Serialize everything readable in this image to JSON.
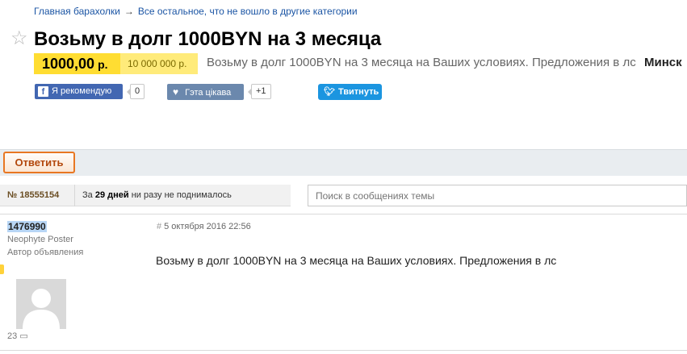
{
  "breadcrumb": {
    "items": [
      "Главная барахолки",
      "Все остальное, что не вошло в другие категории"
    ],
    "separator": "→"
  },
  "header": {
    "title": "Возьму в долг 1000BYN на 3 месяца",
    "star_icon": "star-icon"
  },
  "price": {
    "value": "1000,00",
    "currency": "р.",
    "old_value": "10 000 000 р.",
    "description": "Возьму в долг 1000BYN на 3 месяца на Ваших условиях. Предложения в лс",
    "city": "Минск"
  },
  "social": {
    "facebook_label": "Я рекомендую",
    "facebook_count": "0",
    "vk_label": "Гэта цікава",
    "vk_count": "+1",
    "twitter_label": "Твитнуть"
  },
  "reply": {
    "label": "Ответить"
  },
  "topic": {
    "number": "№ 18555154",
    "age_prefix": "За",
    "age_days": "29 дней",
    "age_suffix": "ни разу не поднималось"
  },
  "search": {
    "placeholder": "Поиск в сообщениях темы"
  },
  "post": {
    "author": "1476990",
    "rank": "Neophyte Poster",
    "role": "Автор объявления",
    "message_count": "23",
    "hash": "#",
    "date": "5 октября 2016 22:56",
    "text": "Возьму в долг 1000BYN на 3 месяца на Ваших условиях. Предложения в лс"
  },
  "colors": {
    "link": "#1b55a4",
    "price_bg": "#ffdd32",
    "reply_border": "#e87722",
    "facebook": "#4267b2",
    "vk": "#6b88ad",
    "twitter": "#1b95e0"
  }
}
